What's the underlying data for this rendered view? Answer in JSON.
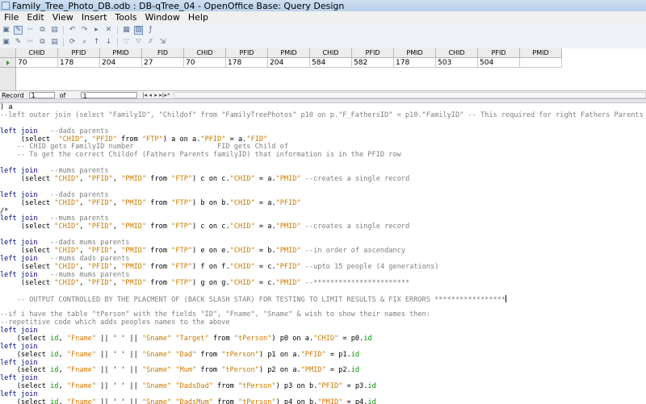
{
  "window": {
    "title": "Family_Tree_Photo_DB.odb : DB-qTree_04 - OpenOffice Base: Query Design"
  },
  "menu": [
    "File",
    "Edit",
    "View",
    "Insert",
    "Tools",
    "Window",
    "Help"
  ],
  "toolbar1": {
    "buttons": [
      {
        "icon": "save-icon",
        "glyph": "▣"
      },
      {
        "icon": "edit-icon",
        "glyph": "✎",
        "active": true
      },
      {
        "icon": "cut-icon",
        "glyph": "✂",
        "disabled": true
      },
      {
        "icon": "copy-icon",
        "glyph": "⧉"
      },
      {
        "icon": "paste-icon",
        "glyph": "▤"
      },
      {
        "icon": "undo-icon",
        "glyph": "↶"
      },
      {
        "icon": "redo-icon",
        "glyph": "↷"
      },
      {
        "icon": "run-query-icon",
        "glyph": "▸"
      },
      {
        "icon": "clear-query-icon",
        "glyph": "✕"
      },
      {
        "icon": "design-view-icon",
        "glyph": "▦"
      },
      {
        "icon": "sql-toggle-icon",
        "glyph": "▧",
        "active": true
      },
      {
        "icon": "functions-icon",
        "glyph": "ƒ"
      }
    ]
  },
  "toolbar2": {
    "buttons": [
      {
        "icon": "save-record-icon",
        "glyph": "▣"
      },
      {
        "icon": "edit-data-icon",
        "glyph": "✎"
      },
      {
        "icon": "cut-icon",
        "glyph": "✂",
        "disabled": true
      },
      {
        "icon": "copy-icon",
        "glyph": "⧉"
      },
      {
        "icon": "paste-icon",
        "glyph": "▤"
      },
      {
        "icon": "refresh-icon",
        "glyph": "⟳"
      },
      {
        "icon": "find-record-icon",
        "glyph": "⌕"
      },
      {
        "icon": "sort-ascending-icon",
        "glyph": "↑"
      },
      {
        "icon": "sort-descending-icon",
        "glyph": "↓"
      },
      {
        "icon": "autofilter-icon",
        "glyph": "▽",
        "disabled": true
      },
      {
        "icon": "standard-filter-icon",
        "glyph": "⛛",
        "disabled": true
      },
      {
        "icon": "remove-filter-icon",
        "glyph": "✗",
        "disabled": true
      },
      {
        "icon": "data-to-text-icon",
        "glyph": "⇲"
      }
    ]
  },
  "grid": {
    "columns": [
      {
        "label": "CHID",
        "w": 52
      },
      {
        "label": "PFID",
        "w": 52
      },
      {
        "label": "PMID",
        "w": 52
      },
      {
        "label": "FID",
        "w": 52
      },
      {
        "label": "CHID",
        "w": 52
      },
      {
        "label": "PFID",
        "w": 52
      },
      {
        "label": "PMID",
        "w": 52
      },
      {
        "label": "CHID",
        "w": 52
      },
      {
        "label": "PFID",
        "w": 52
      },
      {
        "label": "PMID",
        "w": 52
      },
      {
        "label": "CHID",
        "w": 52
      },
      {
        "label": "PFID",
        "w": 52
      },
      {
        "label": "PMID",
        "w": 52
      }
    ],
    "row": [
      "70",
      "178",
      "204",
      "27",
      "70",
      "178",
      "204",
      "584",
      "582",
      "178",
      "503",
      "504",
      ""
    ]
  },
  "record_nav": {
    "label": "Record",
    "current": "1",
    "of_label": "of",
    "total": "1"
  },
  "sql": {
    "lines": [
      [
        [
          "p",
          ") a"
        ]
      ],
      [
        [
          "c",
          "--left outer join (select \"FamilyID\", \"Childof\" from \"FamilyTreePhotos\" p10 on p.\"F_FathersID\" = p10.\"FamilyID\" -- This required for right Fathers Parents"
        ]
      ],
      [
        [
          "p",
          ""
        ]
      ],
      [
        [
          "k",
          "left join"
        ],
        [
          "c",
          "   --dads parents"
        ]
      ],
      [
        [
          "p",
          "     (select  "
        ],
        [
          "s",
          "\"CHID\""
        ],
        [
          "p",
          ", "
        ],
        [
          "s",
          "\"PFID\""
        ],
        [
          "p",
          " from "
        ],
        [
          "s",
          "\"FTP\""
        ],
        [
          "p",
          ") a on a."
        ],
        [
          "s",
          "\"PFID\""
        ],
        [
          "p",
          " = a."
        ],
        [
          "s",
          "\"FID\""
        ]
      ],
      [
        [
          "c",
          "    -- CHID gets FamilyID number                    FID gets Child of"
        ]
      ],
      [
        [
          "c",
          "    -- To get the correct Childof (Fathers Parents familyID) that information is in the PFID row"
        ]
      ],
      [
        [
          "p",
          ""
        ]
      ],
      [
        [
          "k",
          "left join"
        ],
        [
          "c",
          "   --mums parents"
        ]
      ],
      [
        [
          "p",
          "     (select "
        ],
        [
          "s",
          "\"CHID\""
        ],
        [
          "p",
          ", "
        ],
        [
          "s",
          "\"PFID\""
        ],
        [
          "p",
          ", "
        ],
        [
          "s",
          "\"PMID\""
        ],
        [
          "p",
          " from "
        ],
        [
          "s",
          "\"FTP\""
        ],
        [
          "p",
          ") c on c."
        ],
        [
          "s",
          "\"CHID\""
        ],
        [
          "p",
          " = a."
        ],
        [
          "s",
          "\"PMID\""
        ],
        [
          "c",
          " --creates a single record"
        ]
      ],
      [
        [
          "p",
          ""
        ]
      ],
      [
        [
          "k",
          "left join"
        ],
        [
          "c",
          "   --dads parents"
        ]
      ],
      [
        [
          "p",
          "     (select "
        ],
        [
          "s",
          "\"CHID\""
        ],
        [
          "p",
          ", "
        ],
        [
          "s",
          "\"PFID\""
        ],
        [
          "p",
          ", "
        ],
        [
          "s",
          "\"PMID\""
        ],
        [
          "p",
          " from "
        ],
        [
          "s",
          "\"FTP\""
        ],
        [
          "p",
          ") b on b."
        ],
        [
          "s",
          "\"CHID\""
        ],
        [
          "p",
          " = a."
        ],
        [
          "s",
          "\"PFID\""
        ]
      ],
      [
        [
          "p",
          "/*"
        ]
      ],
      [
        [
          "k",
          "left join"
        ],
        [
          "c",
          "   --mums parents"
        ]
      ],
      [
        [
          "p",
          "     (select "
        ],
        [
          "s",
          "\"CHID\""
        ],
        [
          "p",
          ", "
        ],
        [
          "s",
          "\"PFID\""
        ],
        [
          "p",
          ", "
        ],
        [
          "s",
          "\"PMID\""
        ],
        [
          "p",
          " from "
        ],
        [
          "s",
          "\"FTP\""
        ],
        [
          "p",
          ") c on c."
        ],
        [
          "s",
          "\"CHID\""
        ],
        [
          "p",
          " = a."
        ],
        [
          "s",
          "\"PMID\""
        ],
        [
          "c",
          " --creates a single record"
        ]
      ],
      [
        [
          "p",
          ""
        ]
      ],
      [
        [
          "k",
          "left join"
        ],
        [
          "c",
          "   --dads mums parents"
        ]
      ],
      [
        [
          "p",
          "     (select "
        ],
        [
          "s",
          "\"CHID\""
        ],
        [
          "p",
          ", "
        ],
        [
          "s",
          "\"PFID\""
        ],
        [
          "p",
          ", "
        ],
        [
          "s",
          "\"PMID\""
        ],
        [
          "p",
          " from "
        ],
        [
          "s",
          "\"FTP\""
        ],
        [
          "p",
          ") e on e."
        ],
        [
          "s",
          "\"CHID\""
        ],
        [
          "p",
          " = b."
        ],
        [
          "s",
          "\"PMID\""
        ],
        [
          "c",
          " --in order of ascendancy"
        ]
      ],
      [
        [
          "k",
          "left join"
        ],
        [
          "c",
          "   --mums dads parents"
        ]
      ],
      [
        [
          "p",
          "     (select "
        ],
        [
          "s",
          "\"CHID\""
        ],
        [
          "p",
          ", "
        ],
        [
          "s",
          "\"PFID\""
        ],
        [
          "p",
          ", "
        ],
        [
          "s",
          "\"PMID\""
        ],
        [
          "p",
          " from "
        ],
        [
          "s",
          "\"FTP\""
        ],
        [
          "p",
          ") f on f."
        ],
        [
          "s",
          "\"CHID\""
        ],
        [
          "p",
          " = c."
        ],
        [
          "s",
          "\"PFID\""
        ],
        [
          "c",
          " --upto 15 people (4 generations)"
        ]
      ],
      [
        [
          "k",
          "left join"
        ],
        [
          "c",
          "   --mums mums parents"
        ]
      ],
      [
        [
          "p",
          "     (select "
        ],
        [
          "s",
          "\"CHID\""
        ],
        [
          "p",
          ", "
        ],
        [
          "s",
          "\"PFID\""
        ],
        [
          "p",
          ", "
        ],
        [
          "s",
          "\"PMID\""
        ],
        [
          "p",
          " from "
        ],
        [
          "s",
          "\"FTP\""
        ],
        [
          "p",
          ") g on g."
        ],
        [
          "s",
          "\"CHID\""
        ],
        [
          "p",
          " = c."
        ],
        [
          "s",
          "\"PMID\""
        ],
        [
          "c",
          " --***********************"
        ]
      ],
      [
        [
          "p",
          ""
        ]
      ],
      [
        [
          "c",
          "    -- OUTPUT CONTROLLED BY THE PLACMENT OF (BACK SLASH STAR) FOR TESTING TO LIMIT RESULTS & FIX ERRORS *****************"
        ],
        [
          "cur",
          ""
        ]
      ],
      [
        [
          "p",
          ""
        ]
      ],
      [
        [
          "c",
          "--if i have the table \"tPerson\" with the fields \"ID\", \"Fname\", \"Sname\" & wish to show their names then:"
        ]
      ],
      [
        [
          "c",
          "--repetitive code which adds peoples names to the above"
        ]
      ],
      [
        [
          "k",
          "left join"
        ]
      ],
      [
        [
          "p",
          "    (select "
        ],
        [
          "i",
          "id"
        ],
        [
          "p",
          ", "
        ],
        [
          "s",
          "\"Fname\""
        ],
        [
          "p",
          " || ' ' || "
        ],
        [
          "s",
          "\"Sname\""
        ],
        [
          "p",
          " "
        ],
        [
          "s",
          "\"Target\""
        ],
        [
          "p",
          " from "
        ],
        [
          "s",
          "\"tPerson\""
        ],
        [
          "p",
          ") p0 on a."
        ],
        [
          "s",
          "\"CHID\""
        ],
        [
          "p",
          " = p0."
        ],
        [
          "i",
          "id"
        ]
      ],
      [
        [
          "k",
          "left join"
        ]
      ],
      [
        [
          "p",
          "    (select "
        ],
        [
          "i",
          "id"
        ],
        [
          "p",
          ", "
        ],
        [
          "s",
          "\"Fname\""
        ],
        [
          "p",
          " || ' ' || "
        ],
        [
          "s",
          "\"Sname\""
        ],
        [
          "p",
          " "
        ],
        [
          "s",
          "\"Dad\""
        ],
        [
          "p",
          " from "
        ],
        [
          "s",
          "\"tPerson\""
        ],
        [
          "p",
          ") p1 on a."
        ],
        [
          "s",
          "\"PFID\""
        ],
        [
          "p",
          " = p1."
        ],
        [
          "i",
          "id"
        ]
      ],
      [
        [
          "k",
          "left join"
        ]
      ],
      [
        [
          "p",
          "    (select "
        ],
        [
          "i",
          "id"
        ],
        [
          "p",
          ", "
        ],
        [
          "s",
          "\"Fname\""
        ],
        [
          "p",
          " || ' ' || "
        ],
        [
          "s",
          "\"Sname\""
        ],
        [
          "p",
          " "
        ],
        [
          "s",
          "\"Mum\""
        ],
        [
          "p",
          " from "
        ],
        [
          "s",
          "\"tPerson\""
        ],
        [
          "p",
          ") p2 on a."
        ],
        [
          "s",
          "\"PMID\""
        ],
        [
          "p",
          " = p2."
        ],
        [
          "i",
          "id"
        ]
      ],
      [
        [
          "k",
          "left join"
        ]
      ],
      [
        [
          "p",
          "    (select "
        ],
        [
          "i",
          "id"
        ],
        [
          "p",
          ", "
        ],
        [
          "s",
          "\"Fname\""
        ],
        [
          "p",
          " || ' ' || "
        ],
        [
          "s",
          "\"Sname\""
        ],
        [
          "p",
          " "
        ],
        [
          "s",
          "\"DadsDad\""
        ],
        [
          "p",
          " from "
        ],
        [
          "s",
          "\"tPerson\""
        ],
        [
          "p",
          ") p3 on b."
        ],
        [
          "s",
          "\"PFID\""
        ],
        [
          "p",
          " = p3."
        ],
        [
          "i",
          "id"
        ]
      ],
      [
        [
          "k",
          "left join"
        ]
      ],
      [
        [
          "p",
          "    (select "
        ],
        [
          "i",
          "id"
        ],
        [
          "p",
          ", "
        ],
        [
          "s",
          "\"Fname\""
        ],
        [
          "p",
          " || ' ' || "
        ],
        [
          "s",
          "\"Sname\""
        ],
        [
          "p",
          " "
        ],
        [
          "s",
          "\"DadsMum\""
        ],
        [
          "p",
          " from "
        ],
        [
          "s",
          "\"tPerson\""
        ],
        [
          "p",
          ") p4 on b."
        ],
        [
          "s",
          "\"PMID\""
        ],
        [
          "p",
          " = p4."
        ],
        [
          "i",
          "id"
        ]
      ]
    ]
  }
}
